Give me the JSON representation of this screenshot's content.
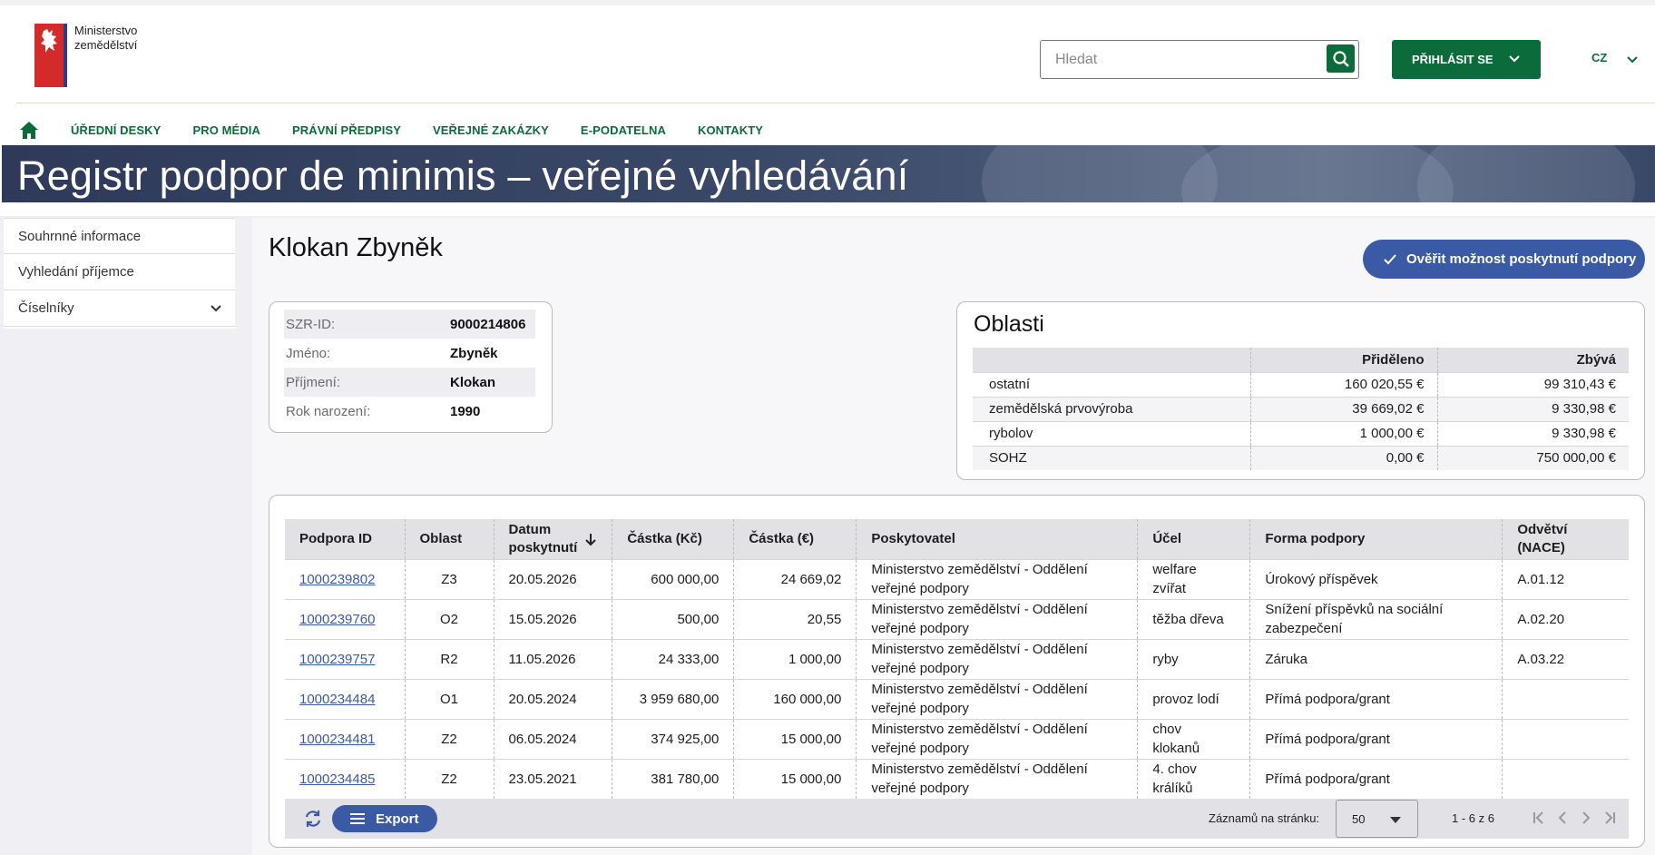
{
  "header": {
    "logo_line1": "Ministerstvo",
    "logo_line2": "zemědělství",
    "search_placeholder": "Hledat",
    "login_label": "PŘIHLÁSIT SE",
    "language": "CZ"
  },
  "nav": {
    "items": [
      "ÚŘEDNÍ DESKY",
      "PRO MÉDIA",
      "PRÁVNÍ PŘEDPISY",
      "VEŘEJNÉ ZAKÁZKY",
      "E-PODATELNA",
      "KONTAKTY"
    ]
  },
  "banner": {
    "title": "Registr podpor de minimis – veřejné vyhledávání"
  },
  "sidebar": {
    "items": [
      {
        "label": "Souhrnné informace"
      },
      {
        "label": "Vyhledání příjemce"
      },
      {
        "label": "Číselníky"
      }
    ]
  },
  "main": {
    "person_name": "Klokan Zbyněk",
    "verify_label": "Ověřit možnost poskytnutí podpory"
  },
  "info": {
    "rows": [
      {
        "key": "SZR-ID:",
        "value": "9000214806"
      },
      {
        "key": "Jméno:",
        "value": "Zbyněk"
      },
      {
        "key": "Příjmení:",
        "value": "Klokan"
      },
      {
        "key": "Rok narození:",
        "value": "1990"
      }
    ]
  },
  "areas": {
    "title": "Oblasti",
    "headers": [
      "",
      "Přiděleno",
      "Zbývá"
    ],
    "rows": [
      [
        "ostatní",
        "160 020,55 €",
        "99 310,43 €"
      ],
      [
        "zemědělská prvovýroba",
        "39 669,02 €",
        "9 330,98 €"
      ],
      [
        "rybolov",
        "1 000,00 €",
        "9 330,98 €"
      ],
      [
        "SOHZ",
        "0,00 €",
        "750 000,00 €"
      ]
    ]
  },
  "grants": {
    "headers": {
      "id": "Podpora ID",
      "area": "Oblast",
      "date_line1": "Datum",
      "date_line2": "poskytnutí",
      "czk": "Částka (Kč)",
      "eur": "Částka (€)",
      "provider": "Poskytovatel",
      "purpose": "Účel",
      "form": "Forma podpory",
      "nace_line1": "Odvětví",
      "nace_line2": "(NACE)"
    },
    "rows": [
      {
        "id": "1000239802",
        "area": "Z3",
        "date": "20.05.2026",
        "czk": "600 000,00",
        "eur": "24 669,02",
        "provider1": "Ministerstvo zemědělství - Oddělení",
        "provider2": "veřejné podpory",
        "purpose1": "welfare",
        "purpose2": "zvířat",
        "form1": "Úrokový příspěvek",
        "form2": "",
        "nace": "A.01.12"
      },
      {
        "id": "1000239760",
        "area": "O2",
        "date": "15.05.2026",
        "czk": "500,00",
        "eur": "20,55",
        "provider1": "Ministerstvo zemědělství - Oddělení",
        "provider2": "veřejné podpory",
        "purpose1": "těžba dřeva",
        "purpose2": "",
        "form1": "Snížení příspěvků na sociální",
        "form2": "zabezpečení",
        "nace": "A.02.20"
      },
      {
        "id": "1000239757",
        "area": "R2",
        "date": "11.05.2026",
        "czk": "24 333,00",
        "eur": "1 000,00",
        "provider1": "Ministerstvo zemědělství - Oddělení",
        "provider2": "veřejné podpory",
        "purpose1": "ryby",
        "purpose2": "",
        "form1": "Záruka",
        "form2": "",
        "nace": "A.03.22"
      },
      {
        "id": "1000234484",
        "area": "O1",
        "date": "20.05.2024",
        "czk": "3 959 680,00",
        "eur": "160 000,00",
        "provider1": "Ministerstvo zemědělství - Oddělení",
        "provider2": "veřejné podpory",
        "purpose1": "provoz lodí",
        "purpose2": "",
        "form1": "Přímá podpora/grant",
        "form2": "",
        "nace": ""
      },
      {
        "id": "1000234481",
        "area": "Z2",
        "date": "06.05.2024",
        "czk": "374 925,00",
        "eur": "15 000,00",
        "provider1": "Ministerstvo zemědělství - Oddělení",
        "provider2": "veřejné podpory",
        "purpose1": "chov",
        "purpose2": "klokanů",
        "form1": "Přímá podpora/grant",
        "form2": "",
        "nace": ""
      },
      {
        "id": "1000234485",
        "area": "Z2",
        "date": "23.05.2021",
        "czk": "381 780,00",
        "eur": "15 000,00",
        "provider1": "Ministerstvo zemědělství - Oddělení",
        "provider2": "veřejné podpory",
        "purpose1": "4. chov",
        "purpose2": "králíků",
        "form1": "Přímá podpora/grant",
        "form2": "",
        "nace": ""
      }
    ]
  },
  "footer": {
    "export_label": "Export",
    "rows_per_page_label": "Záznamů na stránku:",
    "rows_per_page_value": "50",
    "range": "1 - 6 z 6"
  },
  "colors": {
    "brand_green": "#0c6b3b",
    "accent_blue": "#3a5aa5",
    "banner": "#2f3a5a"
  },
  "icons": [
    "lion-emblem-icon",
    "search-icon",
    "chevron-down-icon",
    "home-icon",
    "check-icon",
    "sort-down-icon",
    "refresh-icon",
    "menu-icon",
    "first-page-icon",
    "prev-page-icon",
    "next-page-icon",
    "last-page-icon"
  ]
}
